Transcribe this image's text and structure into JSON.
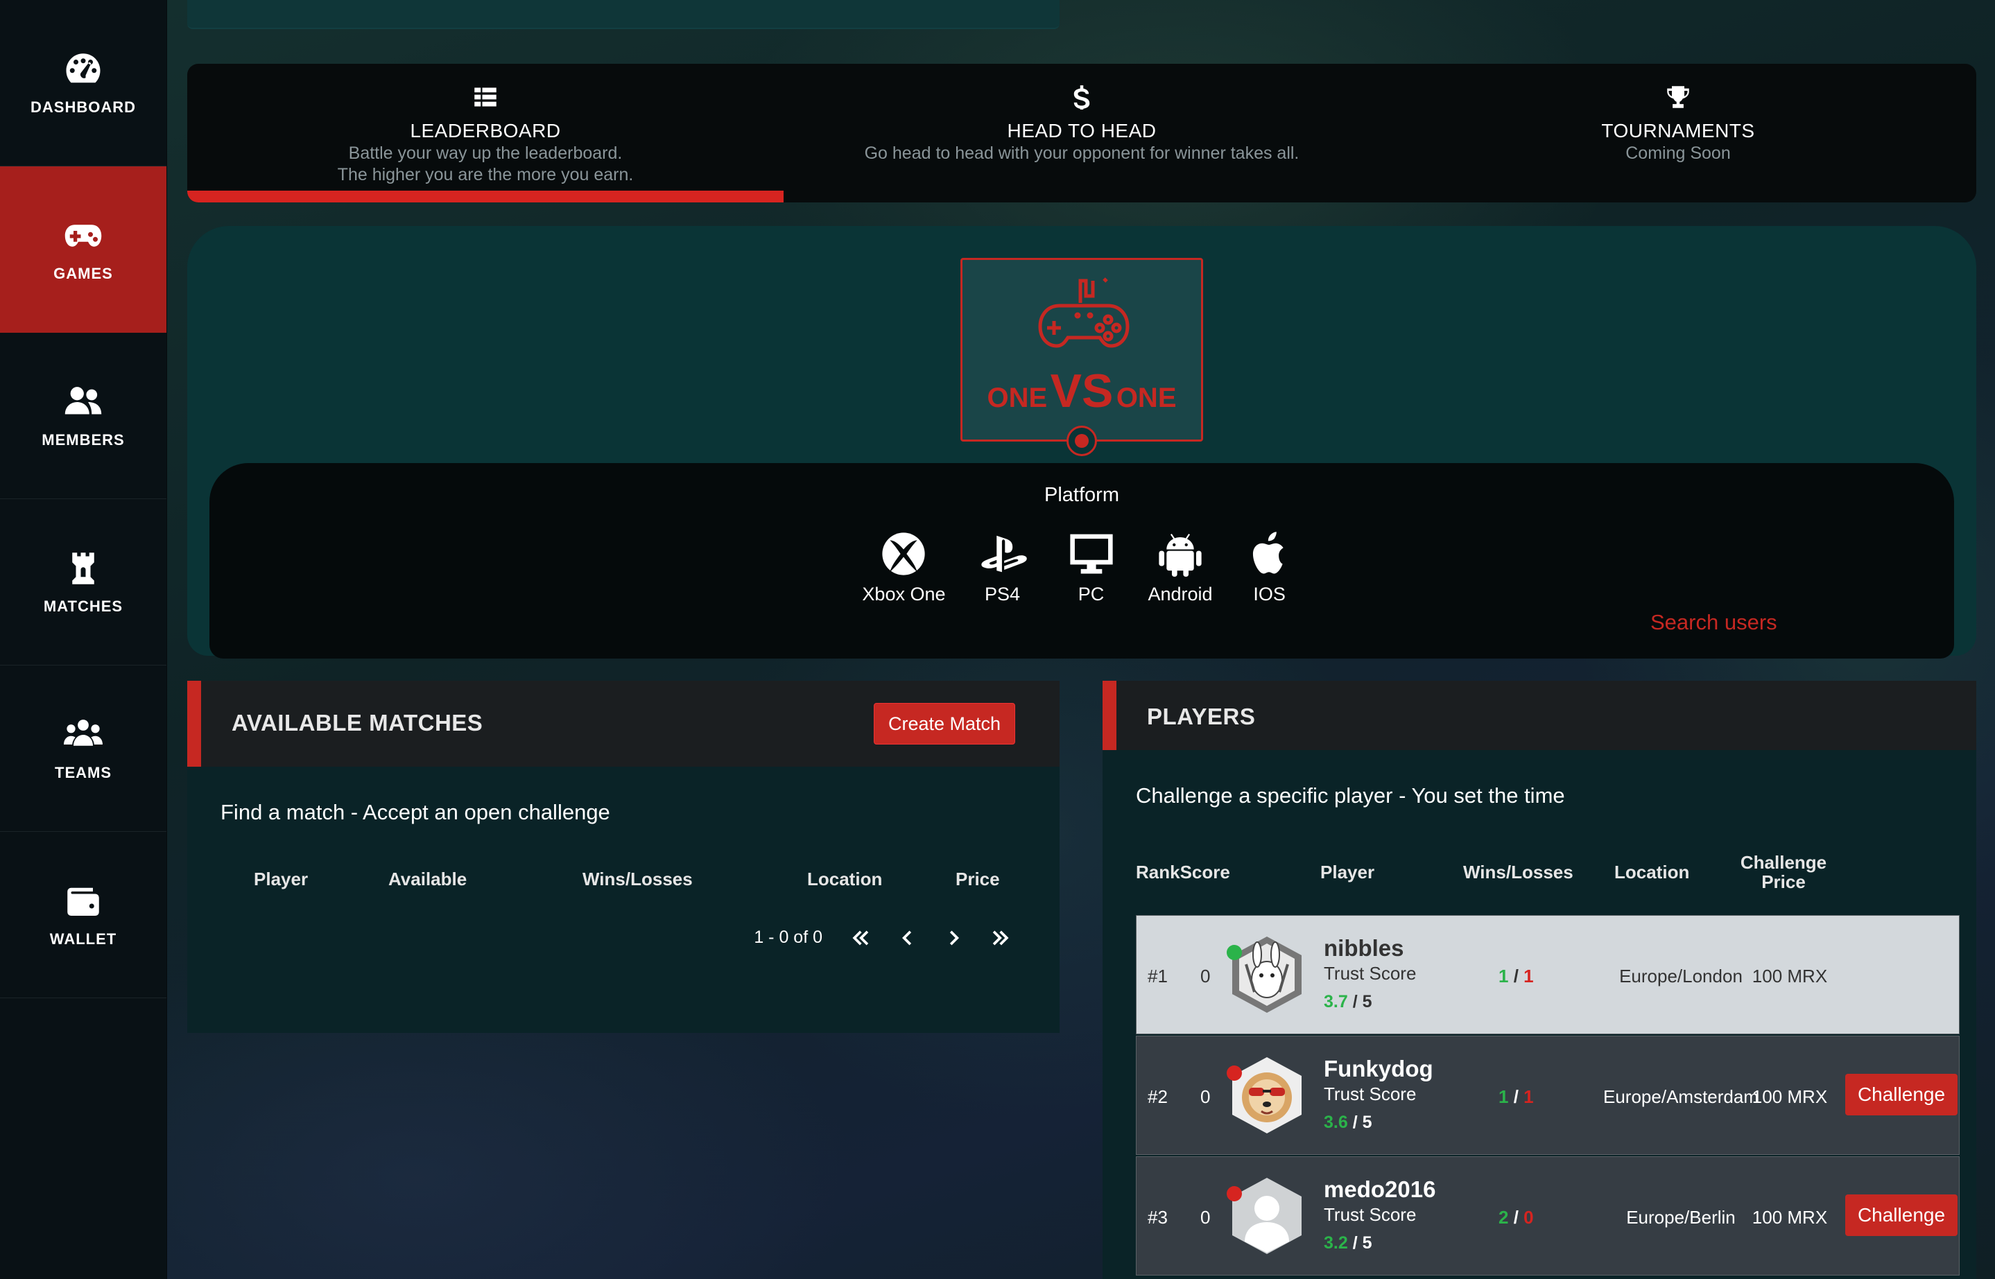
{
  "sidebar": {
    "items": [
      {
        "label": "DASHBOARD",
        "icon": "dashboard-gauge-icon"
      },
      {
        "label": "GAMES",
        "icon": "gamepad-icon",
        "active": true
      },
      {
        "label": "MEMBERS",
        "icon": "users-icon"
      },
      {
        "label": "MATCHES",
        "icon": "rook-tower-icon"
      },
      {
        "label": "TEAMS",
        "icon": "team-icon"
      },
      {
        "label": "WALLET",
        "icon": "wallet-icon"
      }
    ]
  },
  "modes": {
    "leaderboard": {
      "title": "LEADERBOARD",
      "sub1": "Battle your way up the leaderboard.",
      "sub2": "The higher you are the more you earn.",
      "icon": "list-icon",
      "active": true
    },
    "head_to_head": {
      "title": "HEAD TO HEAD",
      "sub1": "Go head to head with your opponent for winner takes all.",
      "icon": "dollar-icon"
    },
    "tournaments": {
      "title": "TOURNAMENTS",
      "sub1": "Coming Soon",
      "icon": "trophy-icon"
    }
  },
  "game_card": {
    "left_word": "ONE",
    "vs": "VS",
    "right_word": "ONE",
    "accent": "#c62822"
  },
  "platform": {
    "label": "Platform",
    "items": [
      "Xbox One",
      "PS4",
      "PC",
      "Android",
      "IOS"
    ]
  },
  "search": {
    "placeholder": "Search users"
  },
  "matches": {
    "title": "AVAILABLE MATCHES",
    "create_label": "Create Match",
    "subtitle": "Find a match - Accept an open challenge",
    "columns": [
      "Player",
      "Available",
      "Wins/Losses",
      "Location",
      "Price"
    ],
    "pager_text": "1 - 0 of 0"
  },
  "players": {
    "title": "PLAYERS",
    "subtitle": "Challenge a specific player - You set the time",
    "columns": {
      "rankscore": "RankScore",
      "player": "Player",
      "winslosses": "Wins/Losses",
      "location": "Location",
      "price1": "Challenge",
      "price2": "Price"
    },
    "trust_label": "Trust Score",
    "challenge_label": "Challenge",
    "rows": [
      {
        "rank": "#1",
        "score": "0",
        "name": "nibbles",
        "trust": "3.7",
        "trust_max": "/ 5",
        "wins": "1",
        "losses": "1",
        "location": "Europe/London",
        "price": "100 MRX",
        "online": true
      },
      {
        "rank": "#2",
        "score": "0",
        "name": "Funkydog",
        "trust": "3.6",
        "trust_max": "/ 5",
        "wins": "1",
        "losses": "1",
        "location": "Europe/Amsterdam",
        "price": "100 MRX",
        "online": false
      },
      {
        "rank": "#3",
        "score": "0",
        "name": "medo2016",
        "trust": "3.2",
        "trust_max": "/ 5",
        "wins": "2",
        "losses": "0",
        "location": "Europe/Berlin",
        "price": "100 MRX",
        "online": false
      }
    ]
  },
  "colors": {
    "accent": "#c62822",
    "win": "#2bb34a",
    "loss": "#d62420",
    "online": "#2bb34a"
  }
}
